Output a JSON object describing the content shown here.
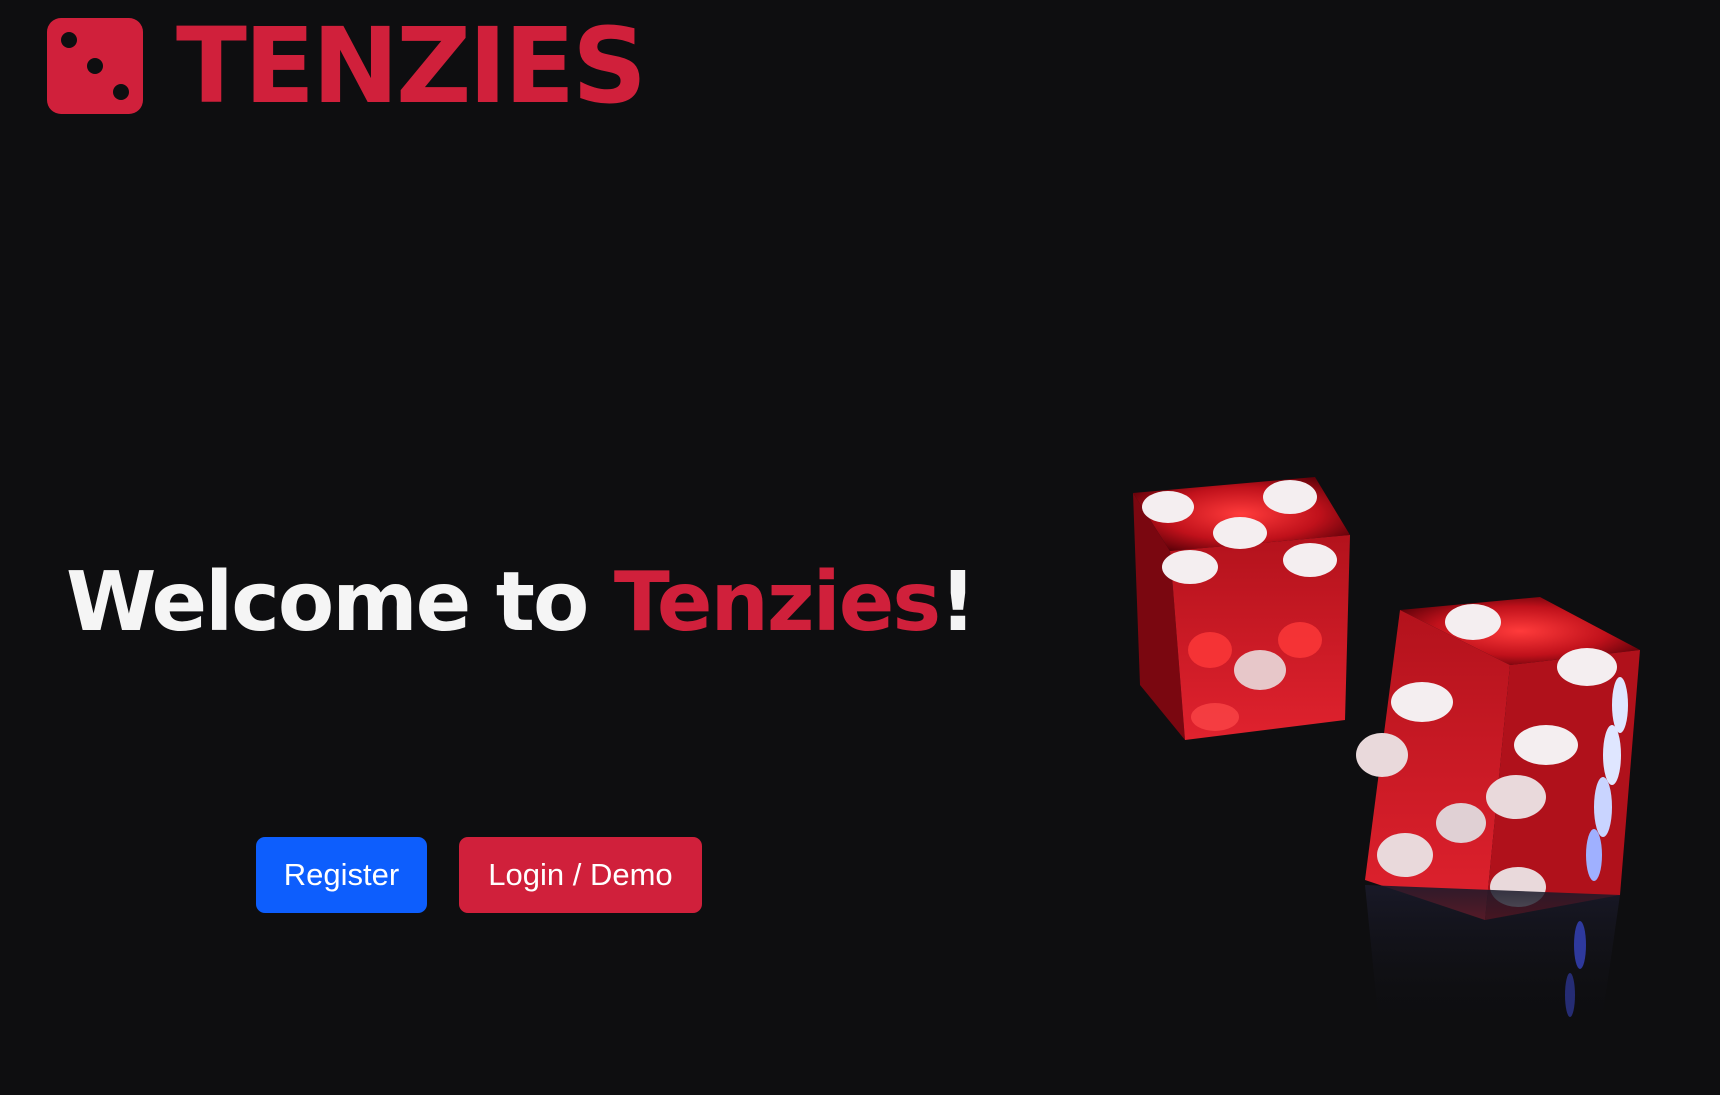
{
  "brand": {
    "name": "TENZIES",
    "icon": "die-three-icon",
    "color": "#d0203b"
  },
  "hero": {
    "title_prefix": "Welcome to ",
    "title_accent": "Tenzies",
    "title_suffix": "!"
  },
  "actions": {
    "register_label": "Register",
    "login_label": "Login / Demo"
  },
  "colors": {
    "background": "#0e0e10",
    "accent_red": "#d0203b",
    "primary_blue": "#0d5efd",
    "text_white": "#f5f5f5"
  },
  "hero_image": {
    "icon": "red-dice-photo"
  }
}
